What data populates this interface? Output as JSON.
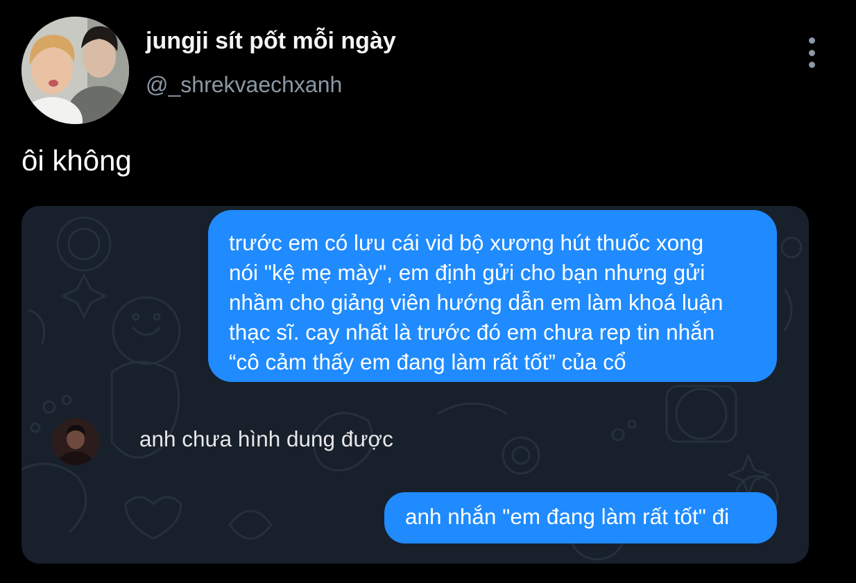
{
  "tweet": {
    "display_name": "jungji sít pốt mỗi ngày",
    "handle": "@_shrekvaechxanh",
    "text": "ôi không",
    "more_icon": "more-vertical-icon"
  },
  "chat_screenshot": {
    "messages": [
      {
        "direction": "outgoing",
        "lines": [
          "trước em có lưu cái vid bộ xương hút thuốc xong",
          "nói \"kệ mẹ mày\", em định gửi cho bạn nhưng gửi",
          "nhầm cho giảng viên hướng dẫn em làm khoá luận",
          "thạc sĩ. cay nhất là trước đó em chưa rep tin nhắn",
          "“cô cảm thấy em đang làm rất tốt” của cổ"
        ]
      },
      {
        "direction": "incoming",
        "text": "anh chưa hình dung được"
      },
      {
        "direction": "outgoing",
        "text": "anh nhắn \"em đang làm rất tốt\" đi"
      }
    ]
  },
  "colors": {
    "page_background": "#000000",
    "bubble_blue": "#1f8bff",
    "chat_background": "#18202c",
    "handle_gray": "#8b98a5"
  }
}
